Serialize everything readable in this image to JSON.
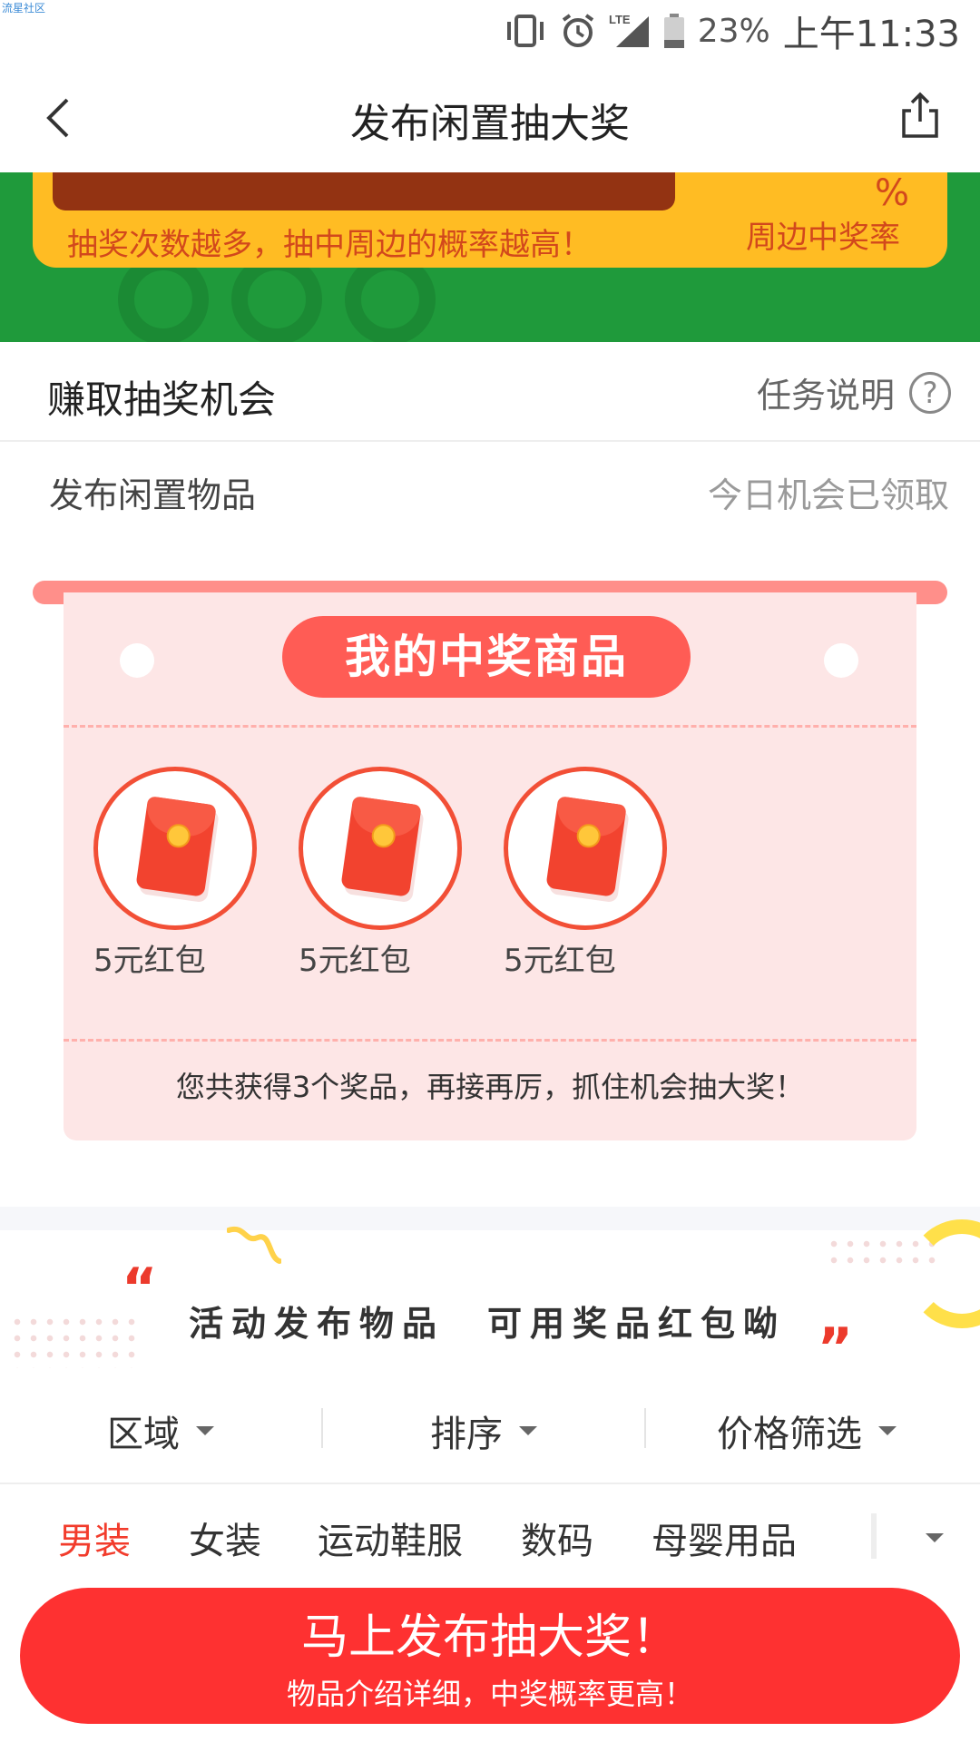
{
  "watermark": "流星社区",
  "status_bar": {
    "battery_percent": "23%",
    "time": "上午11:33",
    "network": "LTE"
  },
  "nav": {
    "title": "发布闲置抽大奖"
  },
  "banner": {
    "tagline": "抽奖次数越多，抽中周边的概率越高！",
    "percent_sign": "%",
    "rate_label": "周边中奖率"
  },
  "earn": {
    "title": "赚取抽奖机会",
    "task_desc": "任务说明",
    "help_symbol": "?",
    "publish_label": "发布闲置物品",
    "publish_status": "今日机会已领取"
  },
  "prizes": {
    "title": "我的中奖商品",
    "items": [
      {
        "label": "5元红包"
      },
      {
        "label": "5元红包"
      },
      {
        "label": "5元红包"
      }
    ],
    "summary": "您共获得3个奖品，再接再厉，抓住机会抽大奖！"
  },
  "activity": {
    "text": "活动发布物品　可用奖品红包呦"
  },
  "filters": [
    {
      "label": "区域"
    },
    {
      "label": "排序"
    },
    {
      "label": "价格筛选"
    }
  ],
  "categories": [
    {
      "label": "男装"
    },
    {
      "label": "女装"
    },
    {
      "label": "运动鞋服"
    },
    {
      "label": "数码"
    },
    {
      "label": "母婴用品"
    }
  ],
  "cta": {
    "title": "马上发布抽大奖！",
    "subtitle": "物品介绍详细，中奖概率更高！"
  }
}
